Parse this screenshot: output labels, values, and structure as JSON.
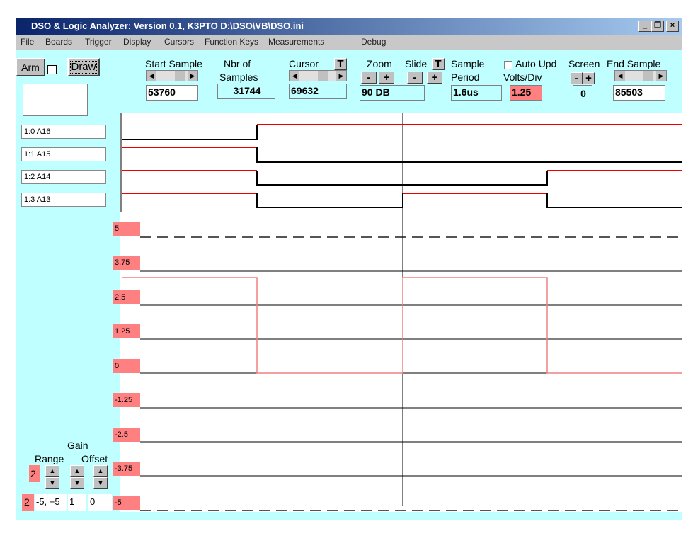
{
  "window": {
    "title": "DSO & Logic Analyzer: Version 0.1, K3PTO  D:\\DSO\\VB\\DSO.ini",
    "min": "_",
    "restore": "❐",
    "close": "×"
  },
  "menu": [
    "File",
    "Boards",
    "Trigger",
    "Display",
    "Cursors",
    "Function Keys",
    "Measurements",
    "Debug"
  ],
  "controls": {
    "arm": "Arm",
    "draw": "Draw",
    "start_sample_label": "Start Sample",
    "start_sample": "53760",
    "nbr_label1": "Nbr of",
    "nbr_label2": "Samples",
    "nbr": "31744",
    "cursor_label": "Cursor",
    "cursor": "69632",
    "t": "T",
    "zoom_label": "Zoom",
    "zoom": "90 DB",
    "slide_label": "Slide",
    "minus": "-",
    "plus": "+",
    "period_label1": "Sample",
    "period_label2": "Period",
    "period": "1.6us",
    "auto_upd": "Auto Upd",
    "volts_label": "Volts/Div",
    "volts": "1.25",
    "screen_label": "Screen",
    "screen": "0",
    "end_sample_label": "End Sample",
    "end_sample": "85503"
  },
  "channels": [
    "1:0 A16",
    "1:1 A15",
    "1:2 A14",
    "1:3 A13"
  ],
  "volt_labels": [
    "5",
    "3.75",
    "2.5",
    "1.25",
    "0",
    "-1.25",
    "-2.5",
    "-3.75",
    "-5"
  ],
  "analog": {
    "gain_label": "Gain",
    "range_label": "Range",
    "offset_label": "Offset",
    "range_sel": "2",
    "channel": "2",
    "range": "-5, +5",
    "gain": "1",
    "offset": "0"
  },
  "colors": {
    "accent": "#ff0000",
    "label_bg": "#ff8080",
    "bg": "#c0ffff"
  }
}
